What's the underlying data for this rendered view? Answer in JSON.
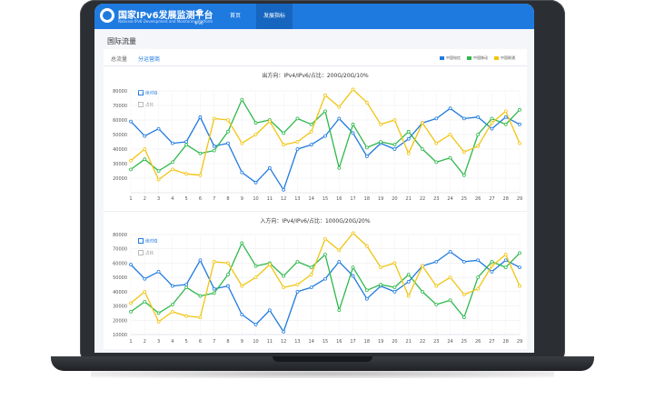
{
  "header": {
    "brand_title": "国家IPv6发展监测平台",
    "brand_subtitle": "National IPv6 Development and Monitoring Platform",
    "ipv6_logo_text": "6",
    "ipv6_logo_label": "IPv6",
    "nav": [
      {
        "label": "首页",
        "active": false
      },
      {
        "label": "发展指标",
        "active": true
      }
    ]
  },
  "page": {
    "title": "国际流量"
  },
  "tabs": [
    {
      "label": "总流量",
      "active": false
    },
    {
      "label": "分运营商",
      "active": true
    }
  ],
  "legend": [
    {
      "label": "中国电信",
      "color": "#1f7ae0"
    },
    {
      "label": "中国移动",
      "color": "#2eb84b"
    },
    {
      "label": "中国联通",
      "color": "#f1c40f"
    }
  ],
  "options": {
    "absolute": "绝对值",
    "ratio": "占比"
  },
  "chart_data": [
    {
      "type": "line",
      "title": "出方向：IPv4/IPv6/占比：200G/20G/10%",
      "x": [
        1,
        2,
        3,
        4,
        5,
        6,
        7,
        8,
        9,
        10,
        11,
        12,
        13,
        14,
        15,
        16,
        17,
        18,
        19,
        20,
        21,
        22,
        23,
        24,
        25,
        26,
        27,
        28,
        29
      ],
      "ylim": [
        10000,
        80000
      ],
      "yticks": [
        20000,
        30000,
        40000,
        50000,
        60000,
        70000,
        80000
      ],
      "series": [
        {
          "name": "中国电信",
          "color": "#1f7ae0",
          "values": [
            59000,
            49000,
            54000,
            44000,
            45000,
            62000,
            42000,
            44000,
            24000,
            17000,
            27000,
            12000,
            40000,
            43000,
            49000,
            61000,
            51000,
            35000,
            44000,
            40000,
            47000,
            58000,
            61000,
            68000,
            61000,
            62000,
            54000,
            62000,
            57000
          ]
        },
        {
          "name": "中国移动",
          "color": "#2eb84b",
          "values": [
            26000,
            33000,
            25000,
            31000,
            43000,
            37000,
            39000,
            52000,
            74000,
            58000,
            60000,
            51000,
            61000,
            57000,
            66000,
            27000,
            57000,
            41000,
            45000,
            43000,
            52000,
            40000,
            31000,
            34000,
            22000,
            50000,
            61000,
            57000,
            67000
          ]
        },
        {
          "name": "中国联通",
          "color": "#f1c40f",
          "values": [
            32000,
            40000,
            19000,
            26000,
            23000,
            22000,
            61000,
            60000,
            44000,
            50000,
            59000,
            43000,
            45000,
            52000,
            77000,
            69000,
            81000,
            72000,
            57000,
            60000,
            37000,
            58000,
            44000,
            50000,
            38000,
            42000,
            58000,
            66000,
            44000
          ]
        }
      ]
    },
    {
      "type": "line",
      "title": "入方向：IPv4/IPv6/占比：1000G/20G/20%",
      "x": [
        1,
        2,
        3,
        4,
        5,
        6,
        7,
        8,
        9,
        10,
        11,
        12,
        13,
        14,
        15,
        16,
        17,
        18,
        19,
        20,
        21,
        22,
        23,
        24,
        25,
        26,
        27,
        28,
        29
      ],
      "ylim": [
        10000,
        80000
      ],
      "yticks": [
        10000,
        20000,
        30000,
        40000,
        50000,
        60000,
        70000,
        80000
      ],
      "series": [
        {
          "name": "中国电信",
          "color": "#1f7ae0",
          "values": [
            59000,
            49000,
            54000,
            44000,
            45000,
            62000,
            42000,
            44000,
            24000,
            17000,
            27000,
            12000,
            40000,
            43000,
            49000,
            61000,
            51000,
            35000,
            44000,
            40000,
            47000,
            58000,
            61000,
            68000,
            61000,
            62000,
            54000,
            62000,
            57000
          ]
        },
        {
          "name": "中国移动",
          "color": "#2eb84b",
          "values": [
            26000,
            33000,
            25000,
            31000,
            43000,
            37000,
            39000,
            52000,
            74000,
            58000,
            60000,
            51000,
            61000,
            57000,
            66000,
            27000,
            57000,
            41000,
            45000,
            43000,
            52000,
            40000,
            31000,
            34000,
            22000,
            50000,
            61000,
            57000,
            67000
          ]
        },
        {
          "name": "中国联通",
          "color": "#f1c40f",
          "values": [
            32000,
            40000,
            19000,
            26000,
            23000,
            22000,
            61000,
            60000,
            44000,
            50000,
            59000,
            43000,
            45000,
            52000,
            77000,
            69000,
            81000,
            72000,
            57000,
            60000,
            37000,
            58000,
            44000,
            50000,
            38000,
            42000,
            58000,
            66000,
            44000
          ]
        }
      ]
    }
  ]
}
